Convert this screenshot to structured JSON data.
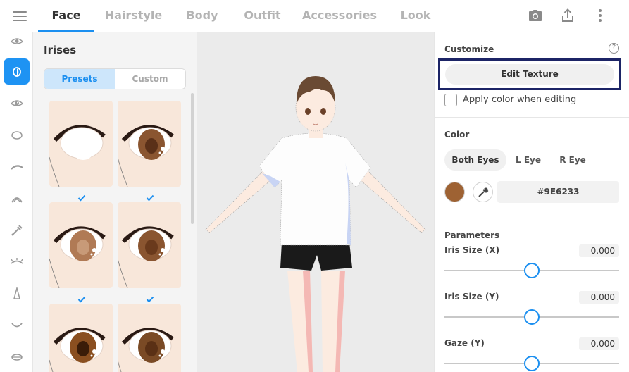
{
  "tabs": [
    {
      "label": "Face"
    },
    {
      "label": "Hairstyle"
    },
    {
      "label": "Body"
    },
    {
      "label": "Outfit"
    },
    {
      "label": "Accessories"
    },
    {
      "label": "Look"
    }
  ],
  "active_tab": "Face",
  "toolbar_icons": [
    "camera-icon",
    "share-icon",
    "more-vertical-icon"
  ],
  "rail_items": [
    "eye-outline",
    "iris",
    "eye-closed-highlight",
    "face-shape",
    "eyebrow",
    "eyelash",
    "eyedropper-makeup",
    "lower-lash",
    "nose",
    "mouth",
    "lips"
  ],
  "rail_active": "iris",
  "panel": {
    "title": "Irises",
    "segments": [
      {
        "label": "Presets"
      },
      {
        "label": "Custom"
      }
    ],
    "active_segment": "Presets",
    "presets": [
      {
        "iris": "#ffffff",
        "pupil": "#ffffff",
        "checked": true
      },
      {
        "iris": "#8a5530",
        "pupil": "#5a3018",
        "checked": true
      },
      {
        "iris": "#b07a55",
        "pupil": "#c89a78",
        "checked": true
      },
      {
        "iris": "#8a5530",
        "pupil": "#6a3a1c",
        "checked": true
      },
      {
        "iris": "#8a4f20",
        "pupil": "#3a1c08",
        "checked": false
      },
      {
        "iris": "#7a4a25",
        "pupil": "#5a3015",
        "checked": false
      }
    ]
  },
  "right": {
    "customize_title": "Customize",
    "help_glyph": "?",
    "edit_texture": "Edit Texture",
    "apply_color": "Apply color when editing",
    "color_title": "Color",
    "eye_tabs": [
      {
        "label": "Both Eyes"
      },
      {
        "label": "L Eye"
      },
      {
        "label": "R Eye"
      }
    ],
    "active_eye_tab": "Both Eyes",
    "color_hex": "#9E6233",
    "swatch_color": "#9e6233",
    "params_title": "Parameters",
    "params": [
      {
        "label": "Iris Size (X)",
        "value": "0.000",
        "level": 0.5
      },
      {
        "label": "Iris Size (Y)",
        "value": "0.000",
        "level": 0.5
      },
      {
        "label": "Gaze (Y)",
        "value": "0.000",
        "level": 0.5
      }
    ]
  }
}
